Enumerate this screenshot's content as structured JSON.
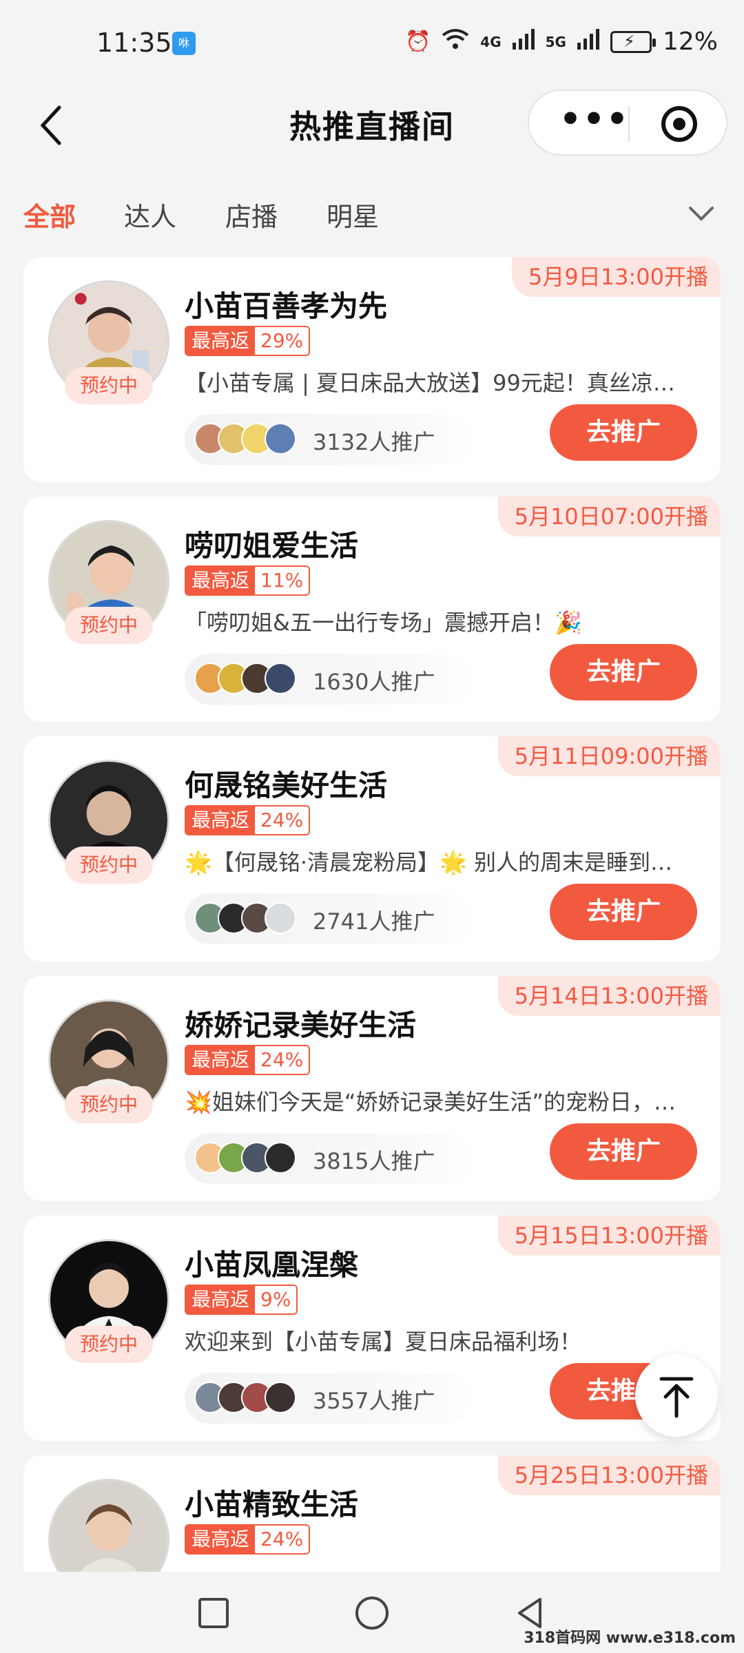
{
  "status_bar": {
    "time": "11:35",
    "app_badge": "咻",
    "net1": "4G",
    "net2": "5G",
    "battery": "12%"
  },
  "nav": {
    "title": "热推直播间",
    "more_label": "•••"
  },
  "tabs": [
    {
      "label": "全部",
      "active": true
    },
    {
      "label": "达人",
      "active": false
    },
    {
      "label": "店播",
      "active": false
    },
    {
      "label": "明星",
      "active": false
    }
  ],
  "cards": [
    {
      "start": "5月9日13:00开播",
      "name": "小苗百善孝为先",
      "rebate_label": "最高返",
      "rebate": "29%",
      "desc": "【小苗专属 | 夏日床品大放送】99元起！真丝凉…",
      "status": "预约中",
      "promoters": "3132人推广",
      "button": "去推广"
    },
    {
      "start": "5月10日07:00开播",
      "name": "唠叨姐爱生活",
      "rebate_label": "最高返",
      "rebate": "11%",
      "desc": "「唠叨姐&五一出行专场」震撼开启！🎉",
      "status": "预约中",
      "promoters": "1630人推广",
      "button": "去推广"
    },
    {
      "start": "5月11日09:00开播",
      "name": "何晟铭美好生活",
      "rebate_label": "最高返",
      "rebate": "24%",
      "desc": "🌟【何晟铭·清晨宠粉局】🌟 别人的周末是睡到…",
      "status": "预约中",
      "promoters": "2741人推广",
      "button": "去推广"
    },
    {
      "start": "5月14日13:00开播",
      "name": "娇娇记录美好生活",
      "rebate_label": "最高返",
      "rebate": "24%",
      "desc": "💥姐妹们今天是“娇娇记录美好生活”的宠粉日，…",
      "status": "预约中",
      "promoters": "3815人推广",
      "button": "去推广"
    },
    {
      "start": "5月15日13:00开播",
      "name": "小苗凤凰涅槃",
      "rebate_label": "最高返",
      "rebate": "9%",
      "desc": "欢迎来到【小苗专属】夏日床品福利场！",
      "status": "预约中",
      "promoters": "3557人推广",
      "button": "去推广"
    },
    {
      "start": "5月25日13:00开播",
      "name": "小苗精致生活",
      "rebate_label": "最高返",
      "rebate": "24%",
      "desc": "",
      "status": "",
      "promoters": "",
      "button": ""
    }
  ],
  "watermark": "318首码网 www.e318.com"
}
